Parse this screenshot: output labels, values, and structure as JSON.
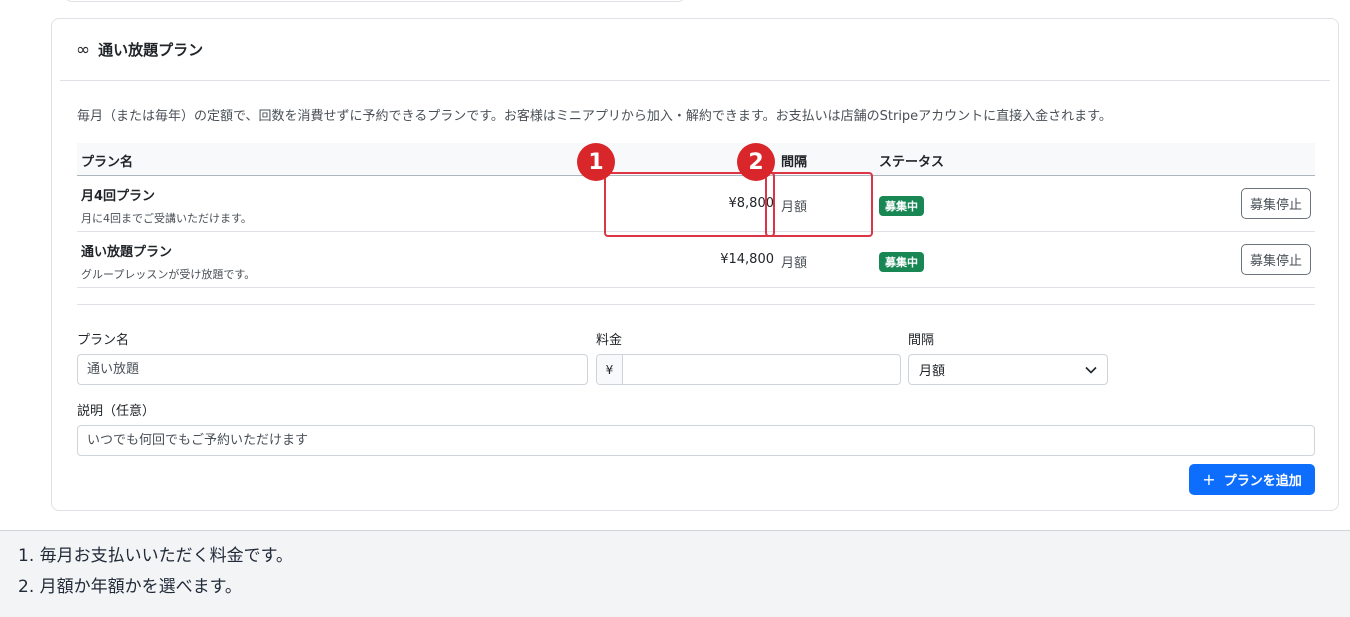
{
  "header": {
    "icon": "infinity-icon",
    "icon_glyph": "∞",
    "title": "通い放題プラン"
  },
  "description": "毎月（または毎年）の定額で、回数を消費せずに予約できるプランです。お客様はミニアプリから加入・解約できます。お支払いは店舗のStripeアカウントに直接入金されます。",
  "table": {
    "columns": [
      "プラン名",
      "間隔",
      "ステータス"
    ],
    "rows": [
      {
        "name": "月4回プラン",
        "desc": "月に4回までご受講いただけます。",
        "price": "¥8,800",
        "interval": "月額",
        "status": "募集中",
        "action": "募集停止"
      },
      {
        "name": "通い放題プラン",
        "desc": "グループレッスンが受け放題です。",
        "price": "¥14,800",
        "interval": "月額",
        "status": "募集中",
        "action": "募集停止"
      }
    ]
  },
  "form": {
    "name_label": "プラン名",
    "name_placeholder": "通い放題",
    "price_label": "料金",
    "price_prefix": "¥",
    "price_value": "",
    "interval_label": "間隔",
    "interval_value": "月額",
    "desc_label": "説明（任意）",
    "desc_placeholder": "いつでも何回でもご予約いただけます",
    "add_button": "プランを追加",
    "add_icon": "plus-icon"
  },
  "annotations": {
    "marker1": "1",
    "marker2": "2"
  },
  "notes": [
    "1. 毎月お支払いいただく料金です。",
    "2. 月額か年額かを選べます。"
  ],
  "colors": {
    "status_badge": "#198754",
    "primary": "#0d6efd",
    "highlight": "#dc3545",
    "marker": "#d9262a"
  }
}
